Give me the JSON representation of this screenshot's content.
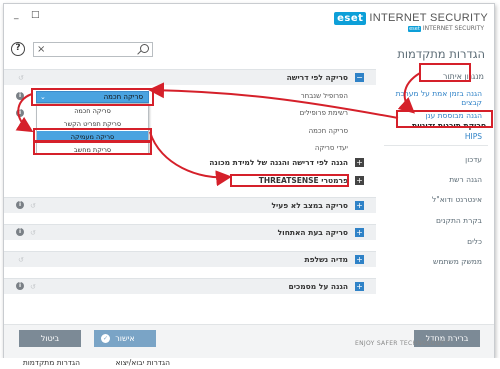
{
  "window": {
    "minimize": "_",
    "maximize": "□",
    "brand_logo": "eset",
    "brand_name": "INTERNET SECURITY",
    "sub_brand_logo": "eset",
    "sub_brand_name": "INTERNET SECURITY"
  },
  "sidebar": {
    "title": "הגדרות מתקדמות",
    "group": "מנגנון איתור",
    "links": [
      "הגנה בזמן אמת על מערכת",
      "קבצים",
      "הגנה מבוססת ענן"
    ],
    "active": "סריקת תוכנות זדוניות",
    "hips": "HIPS",
    "items": [
      "עדכון",
      "הגנה רשת",
      "אינטרנט ודוא\"ל",
      "בקרת התקנים",
      "כלים",
      "ממשק משתמש"
    ]
  },
  "main": {
    "search_clear": "×",
    "help": "?",
    "sections": {
      "on_demand": "סריקה לפי דרישה",
      "on_demand_protection": "הגנה לפי דרישה והגנה של למידת מכונה",
      "threatsense": "פרמטרי THREATSENSE",
      "idle": "סריקה במצב לא פעיל",
      "startup": "סריקה בעת האתחול",
      "removable": "מדיה נשלפת",
      "documents": "הגנה על מסמכים"
    },
    "rows": {
      "selected_profile": "הפרופיל שנבחר",
      "profile_list": "רשימת פרופילים",
      "smart_scan": "סריקה חכמה",
      "scan_targets": "יעדי סריקה"
    },
    "select_value": "סריקה חכמה",
    "dropdown_options": [
      "סריקה חכמה",
      "סריקת תפריט הקשר",
      "סריקה מעמיקה",
      "סריקת מחשב"
    ],
    "reset_icon": "↺",
    "info_icon": "i"
  },
  "footer": {
    "default": "ברירת מחדל",
    "ok": "אישור",
    "cancel": "ביטול",
    "tagline": "ENJOY SAFER TECHNOLOGY™"
  },
  "status": {
    "left": "הגדרות יבוא/יצוא",
    "right": "הגדרות מתקדמות"
  },
  "colors": {
    "accent": "#2f82c7",
    "highlight": "#d5202a",
    "selected": "#4aa3e0"
  }
}
